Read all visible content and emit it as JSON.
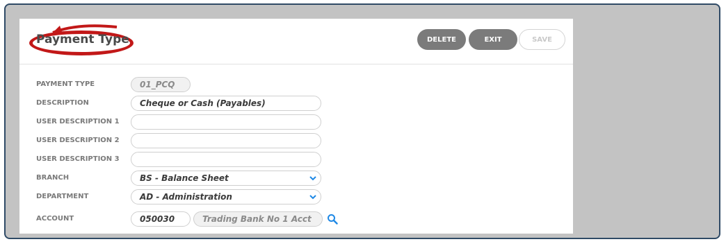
{
  "header": {
    "title": "Payment Type",
    "buttons": {
      "delete": "DELETE",
      "exit": "EXIT",
      "save": "SAVE"
    }
  },
  "form": {
    "payment_type": {
      "label": "PAYMENT TYPE",
      "value": "01_PCQ"
    },
    "description": {
      "label": "DESCRIPTION",
      "value": "Cheque or Cash (Payables)"
    },
    "user_description_1": {
      "label": "USER DESCRIPTION 1",
      "value": ""
    },
    "user_description_2": {
      "label": "USER DESCRIPTION 2",
      "value": ""
    },
    "user_description_3": {
      "label": "USER DESCRIPTION 3",
      "value": ""
    },
    "branch": {
      "label": "BRANCH",
      "value": "BS - Balance Sheet"
    },
    "department": {
      "label": "DEPARTMENT",
      "value": "AD - Administration"
    },
    "account": {
      "label": "ACCOUNT",
      "code": "050030",
      "name": "Trading Bank No 1 Acct"
    }
  },
  "colors": {
    "frame_border": "#2f4a66",
    "background": "#c3c3c3",
    "button_grey": "#7b7b7b",
    "annotation_red": "#c21818",
    "search_icon": "#1e88e5"
  },
  "icons": [
    "chevron-down-icon",
    "search-icon"
  ]
}
